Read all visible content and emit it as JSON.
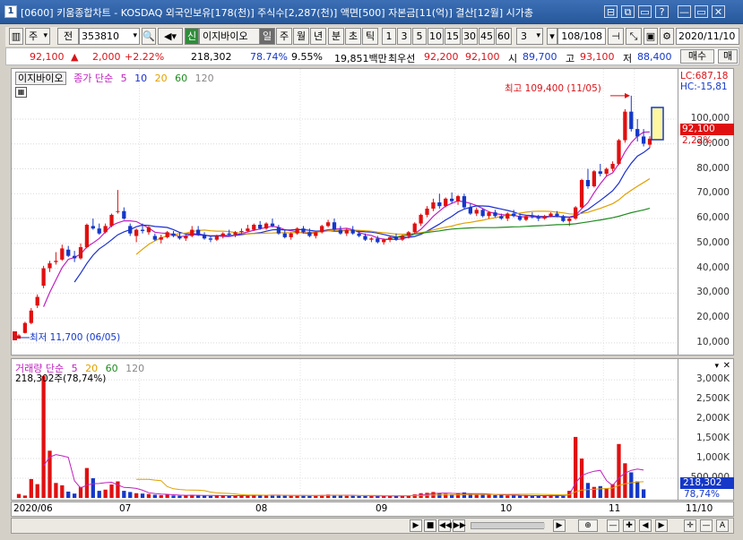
{
  "window": {
    "number": "1",
    "title": "[0600] 키움종합차트 - KOSDAQ 외국인보유[178(천)] 주식수[2,287(천)] 액면[500] 자본금[11(억)] 결산[12월] 시가총",
    "buttons": [
      "⊟",
      "⧉",
      "▭",
      "?",
      "—",
      "▭",
      "✕"
    ]
  },
  "toolbar": {
    "period_type": "주",
    "prev_label": "전",
    "code": "353810",
    "stock_name": "이지바이오",
    "badge": "신",
    "periods": [
      "일",
      "주",
      "월",
      "년",
      "분",
      "초",
      "틱"
    ],
    "numbers": [
      "1",
      "3",
      "5",
      "10",
      "15",
      "30",
      "45",
      "60"
    ],
    "custom": "3",
    "page_count": "108/108",
    "date": "2020/11/10"
  },
  "quote": {
    "price": "92,100",
    "change": "2,000",
    "change_pct": "+2.22%",
    "volume": "218,302",
    "vol_ratio": "78.74%",
    "turnover": "9.55%",
    "amount": "19,851백만",
    "best_ask_label": "최우선",
    "best_ask": "92,200",
    "best_bid": "92,100",
    "open_label": "시",
    "open": "89,700",
    "high_label": "고",
    "high": "93,100",
    "low_label": "저",
    "low": "88,400",
    "buy_label": "매수",
    "sell_label": "매"
  },
  "price_pane": {
    "name_label": "이지바이오",
    "legend_main": "종가 단순",
    "ma": [
      "5",
      "10",
      "20",
      "60",
      "120"
    ],
    "ma_colors": [
      "#c020c0",
      "#1a2fd0",
      "#e0a000",
      "#1f8a1f",
      "#888888"
    ],
    "lc": "LC:687,18",
    "hc": "HC:-15,81",
    "current_price": "92,100",
    "current_pct": "2,22%",
    "max_note": "최고 109,400 (11/05)",
    "min_note": "최저 11,700 (06/05)",
    "yticks": [
      "100,000",
      "90,000",
      "80,000",
      "70,000",
      "60,000",
      "50,000",
      "40,000",
      "30,000",
      "20,000",
      "10,000"
    ]
  },
  "volume_pane": {
    "legend_main": "거래량 단순",
    "ma": [
      "5",
      "20",
      "60",
      "120"
    ],
    "ma_colors": [
      "#c020c0",
      "#e0a000",
      "#1f8a1f",
      "#888888"
    ],
    "volume_note": "218,302주(78,74%)",
    "yticks": [
      "3,000K",
      "2,500K",
      "2,000K",
      "1,500K",
      "1,000K",
      "500,000"
    ],
    "current_volume": "218,302",
    "current_pct": "78,74%"
  },
  "xaxis": {
    "labels": [
      "2020/06",
      "07",
      "08",
      "09",
      "10",
      "11",
      "11/10"
    ]
  },
  "chart_data": {
    "type": "candlestick",
    "ylim": [
      6000,
      118000
    ],
    "candles": [
      [
        11700,
        13500,
        11700,
        13000
      ],
      [
        14000,
        18500,
        13800,
        18000
      ],
      [
        18000,
        24000,
        17500,
        23000
      ],
      [
        25000,
        29500,
        24000,
        28500
      ],
      [
        33000,
        41000,
        32000,
        40000
      ],
      [
        40000,
        43000,
        38500,
        42000
      ],
      [
        42500,
        46500,
        41500,
        43000
      ],
      [
        43500,
        49500,
        43000,
        48000
      ],
      [
        47500,
        49000,
        44500,
        45000
      ],
      [
        45000,
        47000,
        42500,
        44000
      ],
      [
        44000,
        50000,
        43500,
        48500
      ],
      [
        48500,
        58000,
        48000,
        57500
      ],
      [
        57000,
        60000,
        55500,
        56000
      ],
      [
        56000,
        58000,
        53500,
        54000
      ],
      [
        54500,
        58000,
        54000,
        57000
      ],
      [
        57000,
        62000,
        56500,
        61500
      ],
      [
        63000,
        71500,
        62000,
        63000
      ],
      [
        63000,
        64500,
        59500,
        60000
      ],
      [
        57000,
        58000,
        53000,
        54000
      ],
      [
        53000,
        56000,
        50500,
        55500
      ],
      [
        55500,
        58000,
        54000,
        55000
      ],
      [
        54500,
        57000,
        53500,
        56500
      ],
      [
        53000,
        54000,
        51000,
        51500
      ],
      [
        51500,
        53500,
        50000,
        52500
      ],
      [
        52500,
        55000,
        52000,
        54500
      ],
      [
        54000,
        55000,
        52500,
        53000
      ],
      [
        53000,
        54500,
        51500,
        52000
      ],
      [
        52000,
        53500,
        51000,
        53000
      ],
      [
        53000,
        57000,
        52500,
        55500
      ],
      [
        55500,
        57000,
        53000,
        53500
      ],
      [
        53500,
        54500,
        51500,
        52000
      ],
      [
        52000,
        53000,
        50500,
        51500
      ],
      [
        51500,
        53500,
        51000,
        53000
      ],
      [
        53000,
        54500,
        52000,
        54000
      ],
      [
        54000,
        55500,
        53000,
        53500
      ],
      [
        53500,
        55000,
        52500,
        54500
      ],
      [
        54500,
        56000,
        53500,
        55000
      ],
      [
        55000,
        57500,
        54500,
        56000
      ],
      [
        55500,
        58000,
        55000,
        57500
      ],
      [
        57500,
        59000,
        55500,
        56000
      ],
      [
        56000,
        58500,
        55500,
        58000
      ],
      [
        58000,
        60000,
        56500,
        57000
      ],
      [
        56500,
        57500,
        53500,
        54000
      ],
      [
        54000,
        55500,
        52000,
        52500
      ],
      [
        52500,
        54500,
        51500,
        54000
      ],
      [
        54000,
        56500,
        53500,
        56000
      ],
      [
        56000,
        57000,
        54000,
        54500
      ],
      [
        54500,
        56000,
        52500,
        53000
      ],
      [
        53000,
        55000,
        52000,
        54500
      ],
      [
        54500,
        57500,
        54000,
        57000
      ],
      [
        57000,
        59500,
        56500,
        58500
      ],
      [
        58500,
        60000,
        55000,
        55500
      ],
      [
        55500,
        57000,
        53500,
        54000
      ],
      [
        54000,
        56000,
        53000,
        55500
      ],
      [
        55500,
        57000,
        53500,
        54000
      ],
      [
        54000,
        55000,
        52500,
        53000
      ],
      [
        53000,
        54000,
        51000,
        51500
      ],
      [
        51500,
        52500,
        50500,
        52000
      ],
      [
        52000,
        53000,
        50000,
        50500
      ],
      [
        50500,
        52000,
        49500,
        51500
      ],
      [
        51500,
        53000,
        50500,
        52500
      ],
      [
        52500,
        54000,
        51000,
        51500
      ],
      [
        51500,
        53500,
        51000,
        53000
      ],
      [
        53000,
        55000,
        52000,
        54500
      ],
      [
        54500,
        58500,
        54000,
        58000
      ],
      [
        58000,
        62000,
        57000,
        61500
      ],
      [
        61500,
        65000,
        60500,
        64000
      ],
      [
        64000,
        68000,
        63000,
        66500
      ],
      [
        66500,
        70000,
        64000,
        65000
      ],
      [
        65000,
        68500,
        64500,
        68000
      ],
      [
        68000,
        70500,
        66000,
        67000
      ],
      [
        67000,
        69500,
        65500,
        69000
      ],
      [
        69000,
        70000,
        64000,
        64500
      ],
      [
        64500,
        66000,
        61500,
        62000
      ],
      [
        62000,
        64500,
        61000,
        63500
      ],
      [
        63500,
        64000,
        60500,
        61000
      ],
      [
        61000,
        63000,
        60000,
        62500
      ],
      [
        62500,
        63500,
        60500,
        61000
      ],
      [
        61000,
        62000,
        59500,
        60000
      ],
      [
        60000,
        62500,
        59000,
        62000
      ],
      [
        62000,
        63500,
        60500,
        61000
      ],
      [
        61000,
        62000,
        59000,
        59500
      ],
      [
        59500,
        61500,
        59000,
        61000
      ],
      [
        61000,
        62500,
        60000,
        60500
      ],
      [
        60500,
        61500,
        59000,
        60000
      ],
      [
        60000,
        61500,
        59500,
        61000
      ],
      [
        61000,
        62500,
        60500,
        62000
      ],
      [
        62000,
        63000,
        60500,
        61000
      ],
      [
        61000,
        61500,
        58500,
        59000
      ],
      [
        59000,
        60500,
        57000,
        60000
      ],
      [
        60000,
        65000,
        59500,
        64500
      ],
      [
        64500,
        76000,
        64000,
        75500
      ],
      [
        75500,
        80000,
        72000,
        73000
      ],
      [
        73000,
        79500,
        72500,
        79000
      ],
      [
        79000,
        82000,
        77000,
        78000
      ],
      [
        78000,
        80500,
        77000,
        80000
      ],
      [
        80000,
        83000,
        79000,
        82000
      ],
      [
        82000,
        92000,
        81500,
        91500
      ],
      [
        91500,
        104000,
        90500,
        103000
      ],
      [
        103000,
        109400,
        95000,
        96000
      ],
      [
        96000,
        100000,
        91000,
        93000
      ],
      [
        93000,
        96000,
        89000,
        90100
      ],
      [
        89700,
        93100,
        88400,
        92100
      ]
    ],
    "volumes_k": [
      100,
      60,
      480,
      350,
      3100,
      1200,
      380,
      320,
      160,
      110,
      280,
      760,
      500,
      180,
      210,
      340,
      420,
      180,
      150,
      120,
      110,
      100,
      80,
      70,
      90,
      60,
      55,
      60,
      80,
      70,
      55,
      50,
      60,
      65,
      60,
      55,
      60,
      70,
      80,
      70,
      60,
      75,
      65,
      60,
      55,
      65,
      60,
      55,
      60,
      70,
      85,
      70,
      60,
      55,
      60,
      50,
      55,
      50,
      45,
      50,
      55,
      50,
      60,
      55,
      90,
      120,
      130,
      150,
      110,
      100,
      90,
      120,
      140,
      100,
      90,
      80,
      90,
      70,
      80,
      60,
      65,
      55,
      60,
      50,
      60,
      55,
      70,
      60,
      50,
      180,
      1550,
      1000,
      380,
      280,
      300,
      250,
      350,
      1370,
      880,
      650,
      420,
      218
    ],
    "vol_ylim": [
      0,
      3300
    ],
    "x_month_breaks": {
      "07": 20,
      "08": 46,
      "09": 71,
      "10": 95,
      "11": 100
    }
  }
}
